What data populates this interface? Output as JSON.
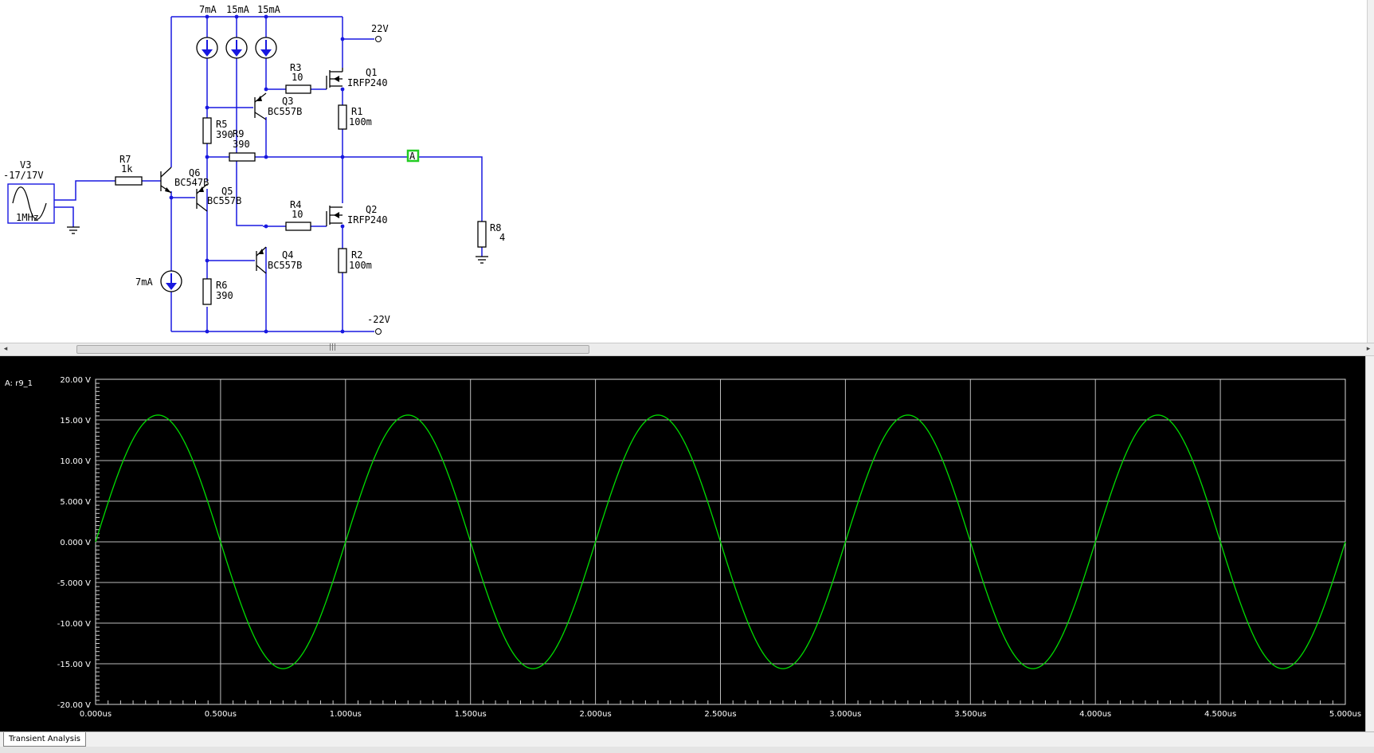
{
  "schematic": {
    "source": {
      "name": "V3",
      "value": "-17/17V",
      "freq": "1MHz"
    },
    "rails": {
      "pos": "22V",
      "neg": "-22V"
    },
    "current_sources": [
      {
        "name": "I-src-top-1",
        "label": "7mA"
      },
      {
        "name": "I-src-top-2",
        "label": "15mA"
      },
      {
        "name": "I-src-top-3",
        "label": "15mA"
      },
      {
        "name": "I-src-bottom",
        "label": "7mA"
      }
    ],
    "resistors": {
      "r1": {
        "name": "R1",
        "value": "100m"
      },
      "r2": {
        "name": "R2",
        "value": "100m"
      },
      "r3": {
        "name": "R3",
        "value": "10"
      },
      "r4": {
        "name": "R4",
        "value": "10"
      },
      "r5": {
        "name": "R5",
        "value": "390"
      },
      "r6": {
        "name": "R6",
        "value": "390"
      },
      "r7": {
        "name": "R7",
        "value": "1k"
      },
      "r8": {
        "name": "R8",
        "value": "4"
      },
      "r9": {
        "name": "R9",
        "value": "390"
      }
    },
    "transistors": {
      "q1": {
        "name": "Q1",
        "model": "IRFP240"
      },
      "q2": {
        "name": "Q2",
        "model": "IRFP240"
      },
      "q3": {
        "name": "Q3",
        "model": "BC557B"
      },
      "q4": {
        "name": "Q4",
        "model": "BC557B"
      },
      "q5": {
        "name": "Q5",
        "model": "BC557B"
      },
      "q6": {
        "name": "Q6",
        "model": "BC547B"
      }
    },
    "probe": {
      "label": "A",
      "color": "#22cc22"
    }
  },
  "grapher": {
    "trace_label": "A: r9_1",
    "trace_color": "#00dd00",
    "tab_label": "Transient Analysis"
  },
  "chart_data": {
    "type": "line",
    "title": "",
    "xlabel": "",
    "ylabel": "",
    "xlim": [
      0,
      5
    ],
    "ylim": [
      -20,
      20
    ],
    "x_unit": "us",
    "x_tick_labels": [
      "0.000us",
      "0.500us",
      "1.000us",
      "1.500us",
      "2.000us",
      "2.500us",
      "3.000us",
      "3.500us",
      "4.000us",
      "4.500us",
      "5.000us"
    ],
    "y_tick_labels": [
      "20.00 V",
      "15.00 V",
      "10.00 V",
      "5.000 V",
      "0.000 V",
      "-5.000 V",
      "-10.00 V",
      "-15.00 V",
      "-20.00 V"
    ],
    "grid": true,
    "series": [
      {
        "name": "A: r9_1",
        "color": "#00dd00",
        "amplitude": 15.6,
        "frequency_mhz": 1,
        "x": [
          0,
          0.25,
          0.5,
          0.75,
          1,
          1.25,
          1.5,
          1.75,
          2,
          2.25,
          2.5,
          2.75,
          3,
          3.25,
          3.5,
          3.75,
          4,
          4.25,
          4.5,
          4.75,
          5
        ],
        "y": [
          0,
          15.6,
          0,
          -15.6,
          0,
          15.6,
          0,
          -15.6,
          0,
          15.6,
          0,
          -15.6,
          0,
          15.6,
          0,
          -15.6,
          0,
          15.6,
          0,
          -15.6,
          0
        ]
      }
    ]
  }
}
